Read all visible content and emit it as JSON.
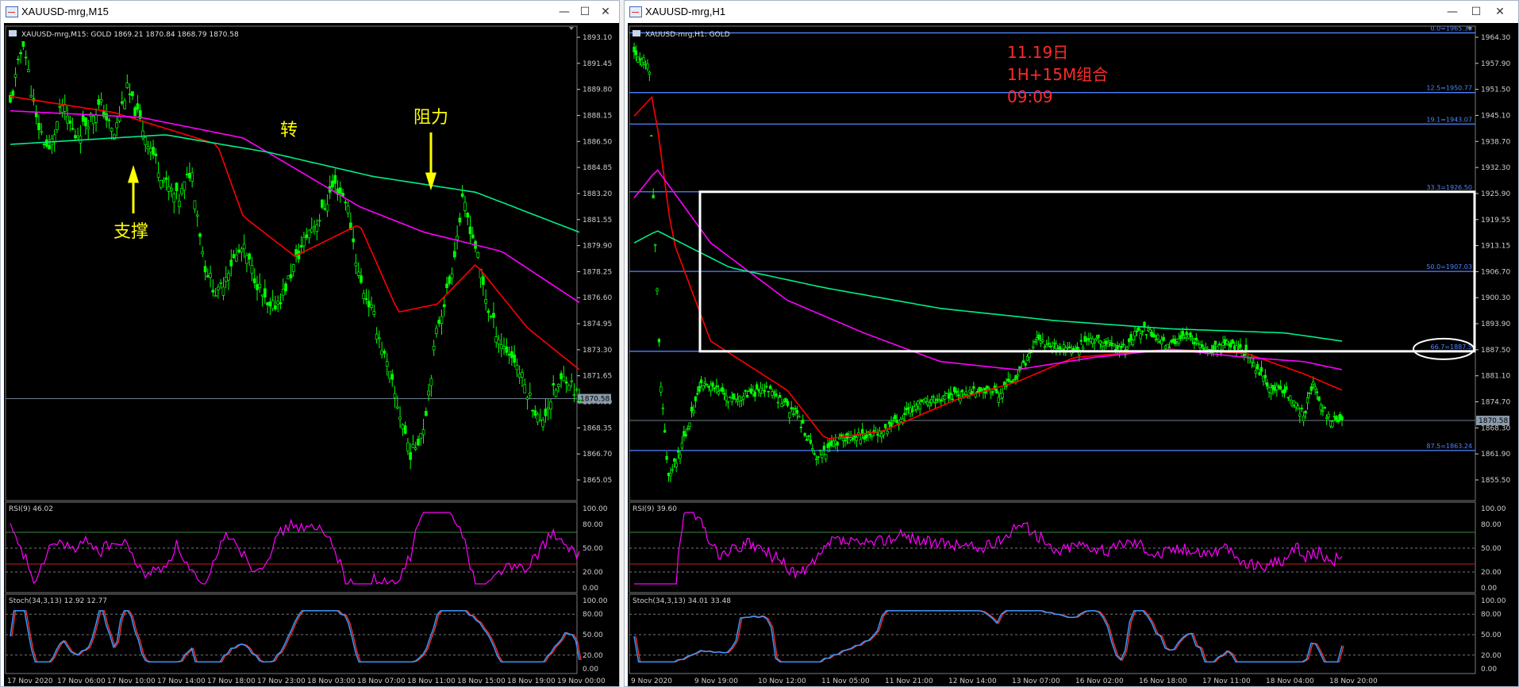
{
  "windows": [
    {
      "id": "m15",
      "title": "XAUUSD-mrg,M15",
      "main": {
        "info": "XAUUSD-mrg,M15:  GOLD   1869.21 1870.84 1868.79 1870.58",
        "price_ticks": [
          "1893.10",
          "1891.45",
          "1889.80",
          "1888.15",
          "1886.50",
          "1884.85",
          "1883.20",
          "1881.55",
          "1879.90",
          "1878.25",
          "1876.60",
          "1874.95",
          "1873.30",
          "1871.65",
          "1870.00",
          "1868.35",
          "1866.70",
          "1865.05"
        ],
        "current_price": "1870.58",
        "annotations": [
          {
            "text": "支撑",
            "arrow": "up"
          },
          {
            "text": "转"
          },
          {
            "text": "阻力",
            "arrow": "down"
          }
        ]
      },
      "rsi": {
        "label": "RSI(9) 46.02",
        "ticks": [
          "100.00",
          "80.00",
          "50.00",
          "20.00",
          "0.00"
        ]
      },
      "stoch": {
        "label": "Stoch(34,3,13) 12.92 12.77",
        "ticks": [
          "100.00",
          "80.00",
          "50.00",
          "20.00",
          "0.00"
        ]
      },
      "time_labels": [
        "17 Nov 2020",
        "17 Nov 06:00",
        "17 Nov 10:00",
        "17 Nov 14:00",
        "17 Nov 18:00",
        "17 Nov 23:00",
        "18 Nov 03:00",
        "18 Nov 07:00",
        "18 Nov 11:00",
        "18 Nov 15:00",
        "18 Nov 19:00",
        "19 Nov 00:00"
      ]
    },
    {
      "id": "h1",
      "title": "XAUUSD-mrg,H1",
      "main": {
        "info": "XAUUSD-mrg,H1:  GOLD",
        "price_ticks": [
          "1964.30",
          "1957.90",
          "1951.50",
          "1945.10",
          "1938.70",
          "1932.30",
          "1925.90",
          "1919.55",
          "1913.15",
          "1906.70",
          "1900.30",
          "1893.90",
          "1887.50",
          "1881.10",
          "1874.70",
          "1868.30",
          "1861.90",
          "1855.50"
        ],
        "current_price": "1870.58",
        "fib_levels": [
          {
            "label": "0.0=1965.36",
            "price": 1965.36
          },
          {
            "label": "12.5=1950.77",
            "price": 1950.77
          },
          {
            "label": "19.1=1943.07",
            "price": 1943.07
          },
          {
            "label": "33.3=1926.50",
            "price": 1926.5
          },
          {
            "label": "50.0=1907.03",
            "price": 1907.03
          },
          {
            "label": "66.7=1887.5",
            "price": 1887.5
          },
          {
            "label": "87.5=1863.24",
            "price": 1863.24
          }
        ],
        "note": [
          "11.19日",
          "1H+15M组合",
          "09:09"
        ]
      },
      "rsi": {
        "label": "RSI(9) 39.60",
        "ticks": [
          "100.00",
          "80.00",
          "50.00",
          "20.00",
          "0.00"
        ]
      },
      "stoch": {
        "label": "Stoch(34,3,13) 34.01 33.48",
        "ticks": [
          "100.00",
          "80.00",
          "50.00",
          "20.00",
          "0.00"
        ]
      },
      "time_labels": [
        "9 Nov 2020",
        "9 Nov 19:00",
        "10 Nov 12:00",
        "11 Nov 05:00",
        "11 Nov 21:00",
        "12 Nov 14:00",
        "13 Nov 07:00",
        "16 Nov 02:00",
        "16 Nov 18:00",
        "17 Nov 11:00",
        "18 Nov 04:00",
        "18 Nov 20:00"
      ]
    }
  ],
  "colors": {
    "candle": "#00ff00",
    "ma_fast": "#ff0000",
    "ma_mid": "#ff00ff",
    "ma_slow": "#00ee88",
    "rsi": "#ff00ff",
    "stoch_main": "#3399ff",
    "stoch_signal": "#ff3030",
    "annotation": "#ffff00",
    "note": "#ff2a2a",
    "fib": "#4f86ff"
  },
  "chart_data": [
    {
      "type": "candlestick",
      "symbol": "XAUUSD-mrg",
      "timeframe": "M15",
      "ylim": [
        1864.2,
        1893.9
      ],
      "price_path": [
        [
          0,
          1889
        ],
        [
          5,
          1893
        ],
        [
          10,
          1888
        ],
        [
          15,
          1886
        ],
        [
          20,
          1889
        ],
        [
          25,
          1887
        ],
        [
          30,
          1888
        ],
        [
          35,
          1889
        ],
        [
          40,
          1887
        ],
        [
          45,
          1890
        ],
        [
          50,
          1888
        ],
        [
          55,
          1886
        ],
        [
          60,
          1884
        ],
        [
          65,
          1883
        ],
        [
          70,
          1885
        ],
        [
          75,
          1879
        ],
        [
          80,
          1877
        ],
        [
          85,
          1879
        ],
        [
          90,
          1880
        ],
        [
          95,
          1878
        ],
        [
          100,
          1876
        ],
        [
          105,
          1877
        ],
        [
          110,
          1879
        ],
        [
          115,
          1881
        ],
        [
          120,
          1882
        ],
        [
          125,
          1884
        ],
        [
          130,
          1883
        ],
        [
          135,
          1878
        ],
        [
          140,
          1876
        ],
        [
          145,
          1873
        ],
        [
          150,
          1870
        ],
        [
          155,
          1867
        ],
        [
          160,
          1869
        ],
        [
          165,
          1875
        ],
        [
          170,
          1878
        ],
        [
          175,
          1883
        ],
        [
          180,
          1880
        ],
        [
          185,
          1876
        ],
        [
          190,
          1874
        ],
        [
          195,
          1873
        ],
        [
          200,
          1871
        ],
        [
          205,
          1869
        ],
        [
          210,
          1871
        ],
        [
          215,
          1872
        ],
        [
          220,
          1870.58
        ]
      ],
      "ma": [
        {
          "name": "fast",
          "points": [
            [
              0,
              1889.5
            ],
            [
              40,
              1888.5
            ],
            [
              80,
              1886.5
            ],
            [
              90,
              1882
            ],
            [
              110,
              1879.5
            ],
            [
              135,
              1881.5
            ],
            [
              150,
              1876
            ],
            [
              165,
              1876.5
            ],
            [
              180,
              1879
            ],
            [
              200,
              1875
            ],
            [
              220,
              1872.4
            ]
          ]
        },
        {
          "name": "mid",
          "points": [
            [
              0,
              1888.6
            ],
            [
              50,
              1888.2
            ],
            [
              90,
              1886.9
            ],
            [
              110,
              1885
            ],
            [
              135,
              1882.6
            ],
            [
              160,
              1881
            ],
            [
              190,
              1879.8
            ],
            [
              220,
              1876.6
            ]
          ]
        },
        {
          "name": "slow",
          "points": [
            [
              0,
              1886.5
            ],
            [
              60,
              1887.1
            ],
            [
              100,
              1886
            ],
            [
              140,
              1884.5
            ],
            [
              180,
              1883.5
            ],
            [
              220,
              1881
            ]
          ]
        }
      ],
      "rsi": {
        "name": "RSI(9)",
        "last": 46.02,
        "levels": [
          70,
          30
        ]
      },
      "stoch": {
        "name": "Stoch(34,3,13)",
        "main": 12.92,
        "signal": 12.77
      }
    },
    {
      "type": "candlestick",
      "symbol": "XAUUSD-mrg",
      "timeframe": "H1",
      "ylim": [
        1851.0,
        1967.0
      ],
      "price_path": [
        [
          0,
          1961
        ],
        [
          8,
          1957
        ],
        [
          10,
          1925
        ],
        [
          14,
          1880
        ],
        [
          18,
          1856
        ],
        [
          25,
          1864
        ],
        [
          35,
          1880
        ],
        [
          50,
          1876
        ],
        [
          70,
          1878
        ],
        [
          85,
          1872
        ],
        [
          95,
          1862
        ],
        [
          110,
          1866
        ],
        [
          130,
          1868
        ],
        [
          150,
          1875
        ],
        [
          170,
          1877
        ],
        [
          180,
          1878
        ],
        [
          190,
          1877
        ],
        [
          200,
          1881
        ],
        [
          210,
          1890
        ],
        [
          220,
          1889
        ],
        [
          230,
          1888
        ],
        [
          240,
          1891
        ],
        [
          255,
          1888
        ],
        [
          265,
          1893
        ],
        [
          280,
          1889
        ],
        [
          290,
          1891
        ],
        [
          300,
          1888
        ],
        [
          310,
          1889
        ],
        [
          320,
          1887
        ],
        [
          330,
          1880
        ],
        [
          340,
          1878
        ],
        [
          350,
          1872
        ],
        [
          355,
          1880
        ],
        [
          360,
          1873
        ],
        [
          365,
          1871
        ],
        [
          370,
          1870.58
        ]
      ],
      "ma": [
        {
          "name": "fast",
          "points": [
            [
              0,
              1945
            ],
            [
              10,
              1950
            ],
            [
              20,
              1915
            ],
            [
              40,
              1890
            ],
            [
              80,
              1878
            ],
            [
              100,
              1866
            ],
            [
              130,
              1868
            ],
            [
              170,
              1876
            ],
            [
              200,
              1880
            ],
            [
              230,
              1886
            ],
            [
              280,
              1888
            ],
            [
              320,
              1887
            ],
            [
              350,
              1882
            ],
            [
              370,
              1878
            ]
          ]
        },
        {
          "name": "mid",
          "points": [
            [
              0,
              1925
            ],
            [
              12,
              1932
            ],
            [
              40,
              1914
            ],
            [
              80,
              1900
            ],
            [
              120,
              1892
            ],
            [
              160,
              1885
            ],
            [
              200,
              1883
            ],
            [
              240,
              1886
            ],
            [
              280,
              1888
            ],
            [
              320,
              1886
            ],
            [
              350,
              1885
            ],
            [
              370,
              1883
            ]
          ]
        },
        {
          "name": "slow",
          "points": [
            [
              0,
              1914
            ],
            [
              12,
              1917
            ],
            [
              50,
              1908
            ],
            [
              100,
              1903
            ],
            [
              160,
              1898
            ],
            [
              220,
              1895
            ],
            [
              280,
              1893
            ],
            [
              340,
              1892
            ],
            [
              370,
              1890
            ]
          ]
        }
      ],
      "rsi": {
        "name": "RSI(9)",
        "last": 39.6,
        "levels": [
          70,
          30
        ]
      },
      "stoch": {
        "name": "Stoch(34,3,13)",
        "main": 34.01,
        "signal": 33.48
      }
    }
  ]
}
